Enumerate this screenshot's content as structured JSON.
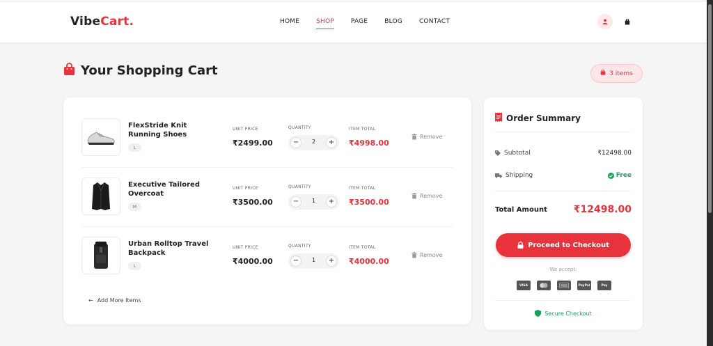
{
  "brand": {
    "name": "Vibe",
    "accent": "Cart.",
    "accent_color": "#e8323c"
  },
  "nav": {
    "items": [
      {
        "label": "HOME",
        "active": false
      },
      {
        "label": "SHOP",
        "active": true
      },
      {
        "label": "PAGE",
        "active": false
      },
      {
        "label": "BLOG",
        "active": false
      },
      {
        "label": "CONTACT",
        "active": false
      }
    ],
    "icons": [
      "user-icon",
      "shopping-bag-icon"
    ]
  },
  "cart": {
    "title": "Your Shopping Cart",
    "badge": "3 items",
    "column_labels": {
      "unit_price": "UNIT PRICE",
      "quantity": "QUANTITY",
      "item_total": "ITEM TOTAL"
    },
    "remove_label": "Remove",
    "items": [
      {
        "name": "FlexStride Knit Running Shoes",
        "size": "L",
        "unit_price": "₹2499.00",
        "quantity": "2",
        "item_total": "₹4998.00",
        "icon": "shoe-icon"
      },
      {
        "name": "Executive Tailored Overcoat",
        "size": "M",
        "unit_price": "₹3500.00",
        "quantity": "1",
        "item_total": "₹3500.00",
        "icon": "coat-icon"
      },
      {
        "name": "Urban Rolltop Travel Backpack",
        "size": "L",
        "unit_price": "₹4000.00",
        "quantity": "1",
        "item_total": "₹4000.00",
        "icon": "backpack-icon"
      }
    ],
    "add_more": "Add More Items"
  },
  "summary": {
    "title": "Order Summary",
    "subtotal_label": "Subtotal",
    "subtotal_value": "₹12498.00",
    "shipping_label": "Shipping",
    "shipping_value": "Free",
    "total_label": "Total Amount",
    "total_value": "₹12498.00",
    "checkout_label": "Proceed to Checkout",
    "accept_label": "We accept:",
    "payment_methods": [
      "VISA",
      "MC",
      "AMEX",
      "PayPal",
      "Pay"
    ],
    "secure_label": "Secure Checkout"
  },
  "colors": {
    "primary": "#e8323c",
    "success": "#1aa25a",
    "text": "#222222"
  }
}
